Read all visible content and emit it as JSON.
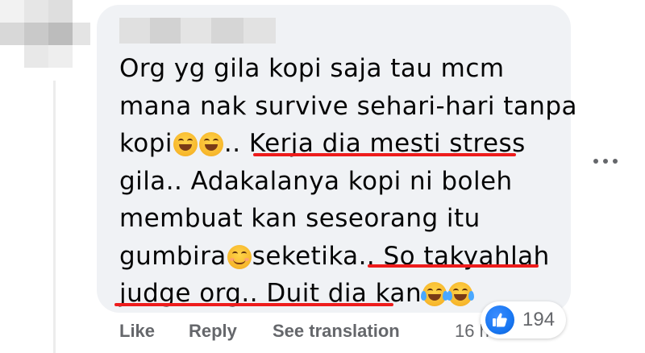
{
  "comment": {
    "lines": [
      "Org yg gila kopi saja tau mcm",
      "mana nak survive sehari-hari tanpa",
      "kopi",
      ".. ",
      "Kerja dia mesti stress",
      "gila.. Adakalanya kopi ni boleh",
      "membuat kan seseorang itu",
      "gumbira",
      "seketika.. ",
      "So takyahlah",
      "judge org.. Duit dia kan"
    ],
    "emojis": [
      "grinning-squinting-face",
      "grinning-squinting-face",
      "smiling-face-with-smiling-eyes",
      "face-with-tears-of-joy",
      "face-with-tears-of-joy"
    ]
  },
  "actions": {
    "like": "Like",
    "reply": "Reply",
    "see_translation": "See translation",
    "time": "16 h"
  },
  "reactions": {
    "icon": "thumbs-up-icon",
    "count": "194"
  },
  "colors": {
    "bubble_bg": "#f0f2f5",
    "underline": "#ee1c1c",
    "like_blue": "#1877f2",
    "meta_grey": "#65676b"
  }
}
